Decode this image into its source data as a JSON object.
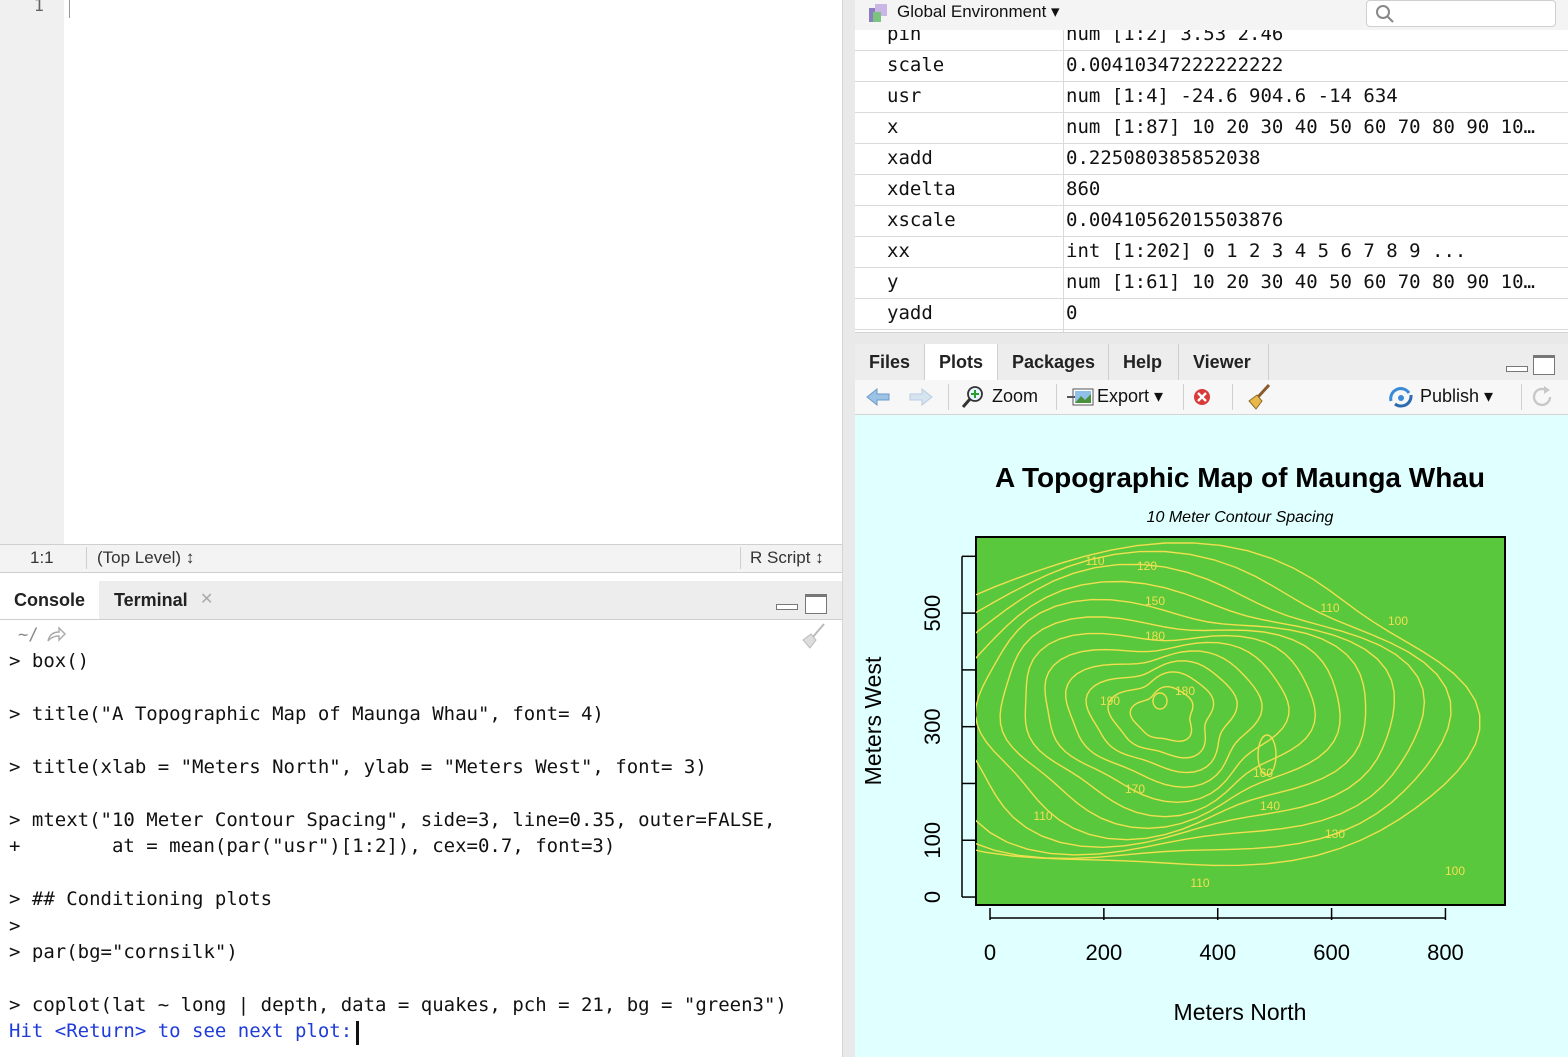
{
  "editor": {
    "line_number": "1",
    "cursor_pos": "1:1",
    "scope": "(Top Level) ↕",
    "file_type": "R Script ↕"
  },
  "console": {
    "tabs": [
      "Console",
      "Terminal"
    ],
    "path": "~/",
    "lines": [
      "> box()",
      "> title(\"A Topographic Map of Maunga Whau\", font= 4)",
      "> title(xlab = \"Meters North\", ylab = \"Meters West\", font= 3)",
      "> mtext(\"10 Meter Contour Spacing\", side=3, line=0.35, outer=FALSE,",
      "+        at = mean(par(\"usr\")[1:2]), cex=0.7, font=3)",
      "> ## Conditioning plots",
      ">",
      "> par(bg=\"cornsilk\")",
      "> coplot(lat ~ long | depth, data = quakes, pch = 21, bg = \"green3\")",
      "Hit <Return> to see next plot: "
    ]
  },
  "environment": {
    "scope_label": "Global Environment ▾",
    "search_placeholder": "",
    "rows": [
      {
        "name": "pin",
        "value": "num [1:2] 3.53 2.46"
      },
      {
        "name": "scale",
        "value": "0.00410347222222222"
      },
      {
        "name": "usr",
        "value": "num [1:4] -24.6 904.6 -14 634"
      },
      {
        "name": "x",
        "value": "num [1:87] 10 20 30 40 50 60 70 80 90 10…"
      },
      {
        "name": "xadd",
        "value": "0.225080385852038"
      },
      {
        "name": "xdelta",
        "value": "860"
      },
      {
        "name": "xscale",
        "value": "0.00410562015503876"
      },
      {
        "name": "xx",
        "value": "int [1:202] 0 1 2 3 4 5 6 7 8 9 ..."
      },
      {
        "name": "y",
        "value": "num [1:61] 10 20 30 40 50 60 70 80 90 10…"
      },
      {
        "name": "yadd",
        "value": "0"
      }
    ]
  },
  "plots_pane": {
    "tabs": [
      "Files",
      "Plots",
      "Packages",
      "Help",
      "Viewer"
    ],
    "active_tab": "Plots",
    "toolbar": {
      "zoom": "Zoom",
      "export": "Export ▾",
      "publish": "Publish ▾"
    }
  },
  "chart_data": {
    "type": "contour",
    "title": "A Topographic Map of Maunga Whau",
    "subtitle": "10 Meter Contour Spacing",
    "xlabel": "Meters North",
    "ylabel": "Meters West",
    "x_ticks": [
      0,
      200,
      400,
      600,
      800
    ],
    "y_ticks": [
      0,
      100,
      300,
      500
    ],
    "xlim": [
      -24.6,
      904.6
    ],
    "ylim": [
      -14,
      634
    ],
    "fill_color": "#5ac83c",
    "line_color": "#f0e050",
    "background": "#e0ffff",
    "contour_labels": [
      "100",
      "110",
      "120",
      "130",
      "140",
      "150",
      "160",
      "170",
      "180",
      "190"
    ]
  }
}
